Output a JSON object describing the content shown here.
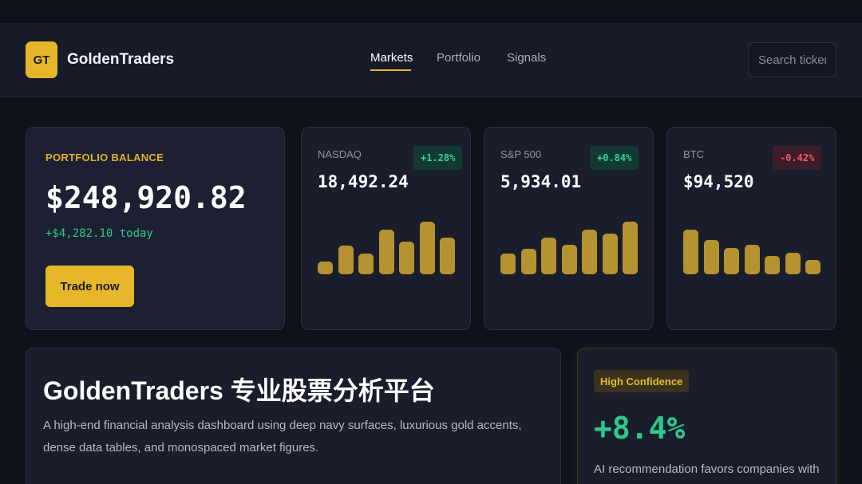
{
  "header": {
    "logo_text": "GT",
    "brand": "GoldenTraders",
    "nav": [
      "Markets",
      "Portfolio",
      "Signals"
    ],
    "active_nav": "Markets",
    "search_placeholder": "Search ticker"
  },
  "balance": {
    "label": "PORTFOLIO BALANCE",
    "value": "$248,920.82",
    "delta": "+$4,282.10 today",
    "cta": "Trade now"
  },
  "tickers": [
    {
      "name": "NASDAQ",
      "value": "18,492.24",
      "change": "+1.28%",
      "direction": "up",
      "bars": [
        0.25,
        0.55,
        0.4,
        0.85,
        0.62,
        1.0,
        0.7
      ]
    },
    {
      "name": "S&P 500",
      "value": "5,934.01",
      "change": "+0.84%",
      "direction": "up",
      "bars": [
        0.4,
        0.48,
        0.7,
        0.56,
        0.85,
        0.78,
        1.0
      ]
    },
    {
      "name": "BTC",
      "value": "$94,520",
      "change": "-0.42%",
      "direction": "down",
      "bars": [
        0.85,
        0.65,
        0.5,
        0.56,
        0.35,
        0.41,
        0.27
      ]
    }
  ],
  "hero": {
    "title": "GoldenTraders 专业股票分析平台",
    "description": "A high-end financial analysis dashboard using deep navy surfaces, luxurious gold accents, dense data tables, and monospaced market figures."
  },
  "signal": {
    "badge": "High Confidence",
    "value": "+8.4%",
    "description": "AI recommendation favors companies with"
  },
  "colors": {
    "accent_gold": "#e6b829",
    "positive": "#2ec98a",
    "negative": "#f2566f",
    "surface": "#1a1e2c",
    "background": "#0f121b"
  }
}
